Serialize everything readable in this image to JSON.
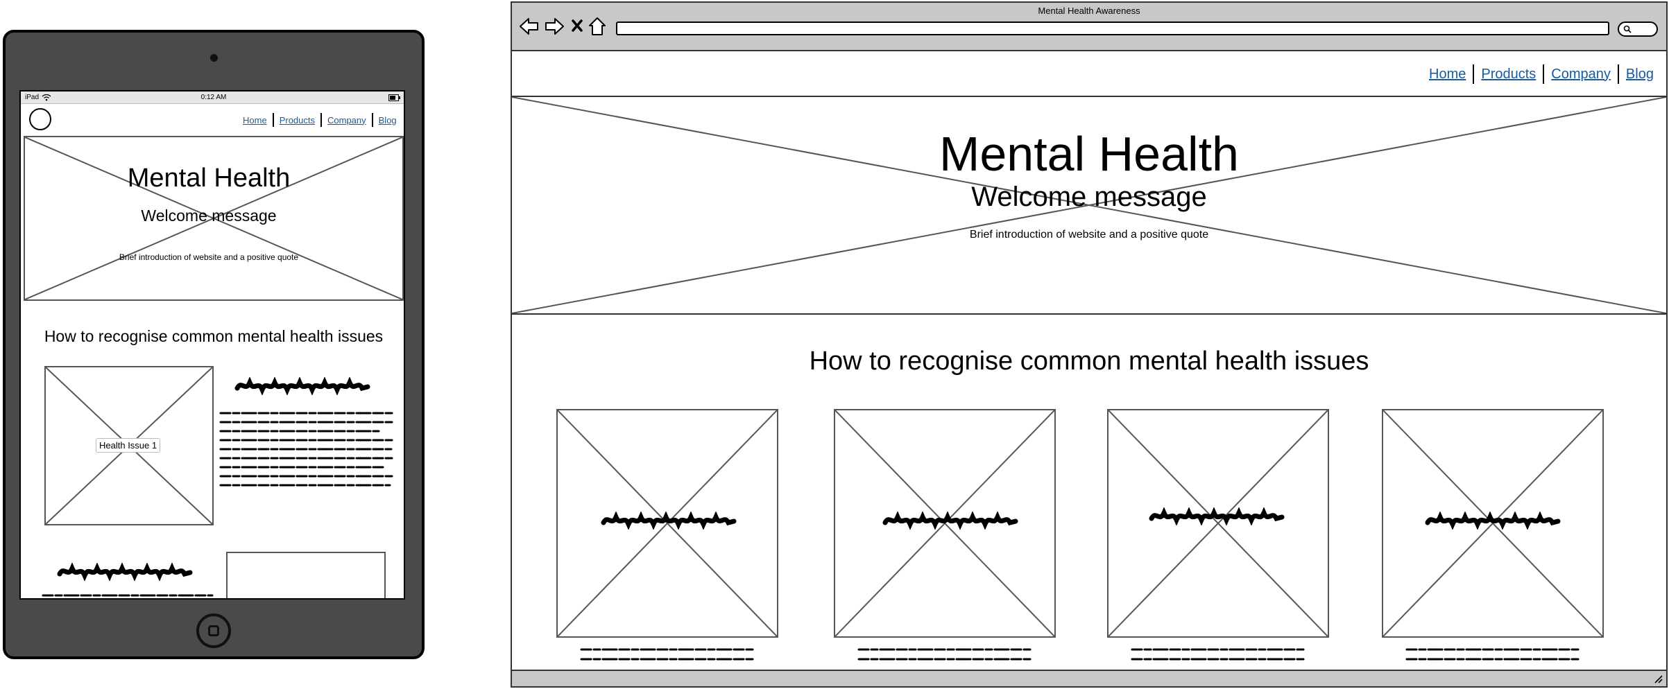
{
  "ipad": {
    "status": {
      "device": "iPad",
      "time": "0:12 AM"
    },
    "nav": [
      "Home",
      "Products",
      "Company",
      "Blog"
    ],
    "hero": {
      "title": "Mental Health",
      "subtitle": "Welcome message",
      "intro": "Brief introduction of website and a positive quote"
    },
    "section_title": "How to recognise common mental health issues",
    "issue_card_label": "Health Issue 1"
  },
  "browser": {
    "title": "Mental Health Awareness",
    "nav": [
      "Home",
      "Products",
      "Company",
      "Blog"
    ],
    "hero": {
      "title": "Mental Health",
      "subtitle": "Welcome message",
      "intro": "Brief introduction of website and a positive quote"
    },
    "section_title": "How to recognise common mental health issues"
  },
  "colors": {
    "device_body": "#4a4a4a",
    "link": "#1a5a9a",
    "browser_chrome": "#c8c8c8"
  }
}
